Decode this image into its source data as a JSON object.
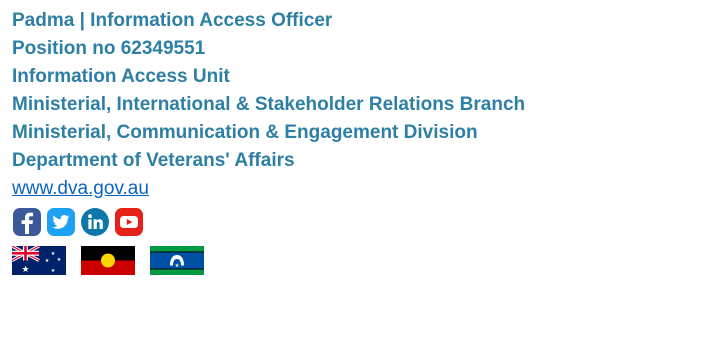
{
  "signature": {
    "name_title": "Padma | Information Access Officer",
    "position": "Position no 62349551",
    "unit": "Information Access Unit",
    "branch": "Ministerial, International & Stakeholder Relations Branch",
    "division": "Ministerial, Communication & Engagement Division",
    "department": "Department of Veterans' Affairs",
    "website": "www.dva.gov.au"
  },
  "social_icons": [
    "facebook-icon",
    "twitter-icon",
    "linkedin-icon",
    "youtube-icon"
  ],
  "flags": [
    "australian-flag",
    "aboriginal-flag",
    "torres-strait-islander-flag"
  ],
  "colors": {
    "text": "#2e7fa4",
    "link": "#0b63c1",
    "facebook": "#3b5998",
    "twitter": "#1da1f2",
    "linkedin": "#0e76a8",
    "youtube": "#e62117"
  }
}
